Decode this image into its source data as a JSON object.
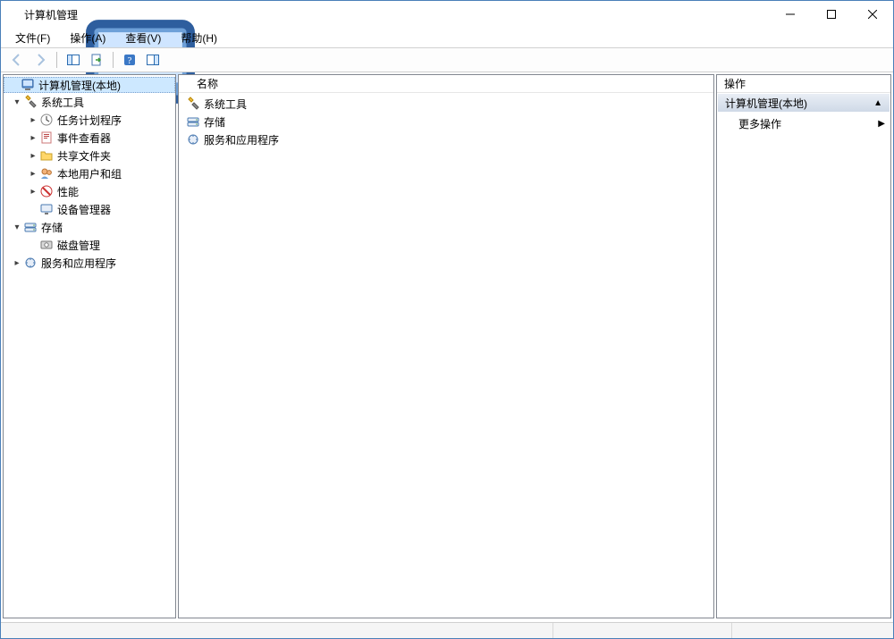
{
  "window": {
    "title": "计算机管理"
  },
  "menu": {
    "file": "文件(F)",
    "action": "操作(A)",
    "view": "查看(V)",
    "help": "帮助(H)"
  },
  "toolbar_icons": {
    "back": "back-icon",
    "forward": "forward-icon",
    "show_hide_tree": "tree-pane-icon",
    "export_list": "export-list-icon",
    "help": "help-icon",
    "show_hide_actions": "actions-pane-icon"
  },
  "tree": {
    "root": {
      "label": "计算机管理(本地)"
    },
    "system_tools": {
      "label": "系统工具",
      "children": {
        "task_scheduler": "任务计划程序",
        "event_viewer": "事件查看器",
        "shared_folders": "共享文件夹",
        "local_users_groups": "本地用户和组",
        "performance": "性能",
        "device_manager": "设备管理器"
      }
    },
    "storage": {
      "label": "存储",
      "children": {
        "disk_mgmt": "磁盘管理"
      }
    },
    "services_apps": {
      "label": "服务和应用程序"
    }
  },
  "list": {
    "header_name": "名称",
    "rows": {
      "0": "系统工具",
      "1": "存储",
      "2": "服务和应用程序"
    }
  },
  "actions": {
    "header": "操作",
    "section_title": "计算机管理(本地)",
    "more_actions": "更多操作"
  },
  "colors": {
    "selection": "#cde8ff",
    "section_grad_top": "#e9eef5",
    "section_grad_bot": "#cfd9e7"
  }
}
